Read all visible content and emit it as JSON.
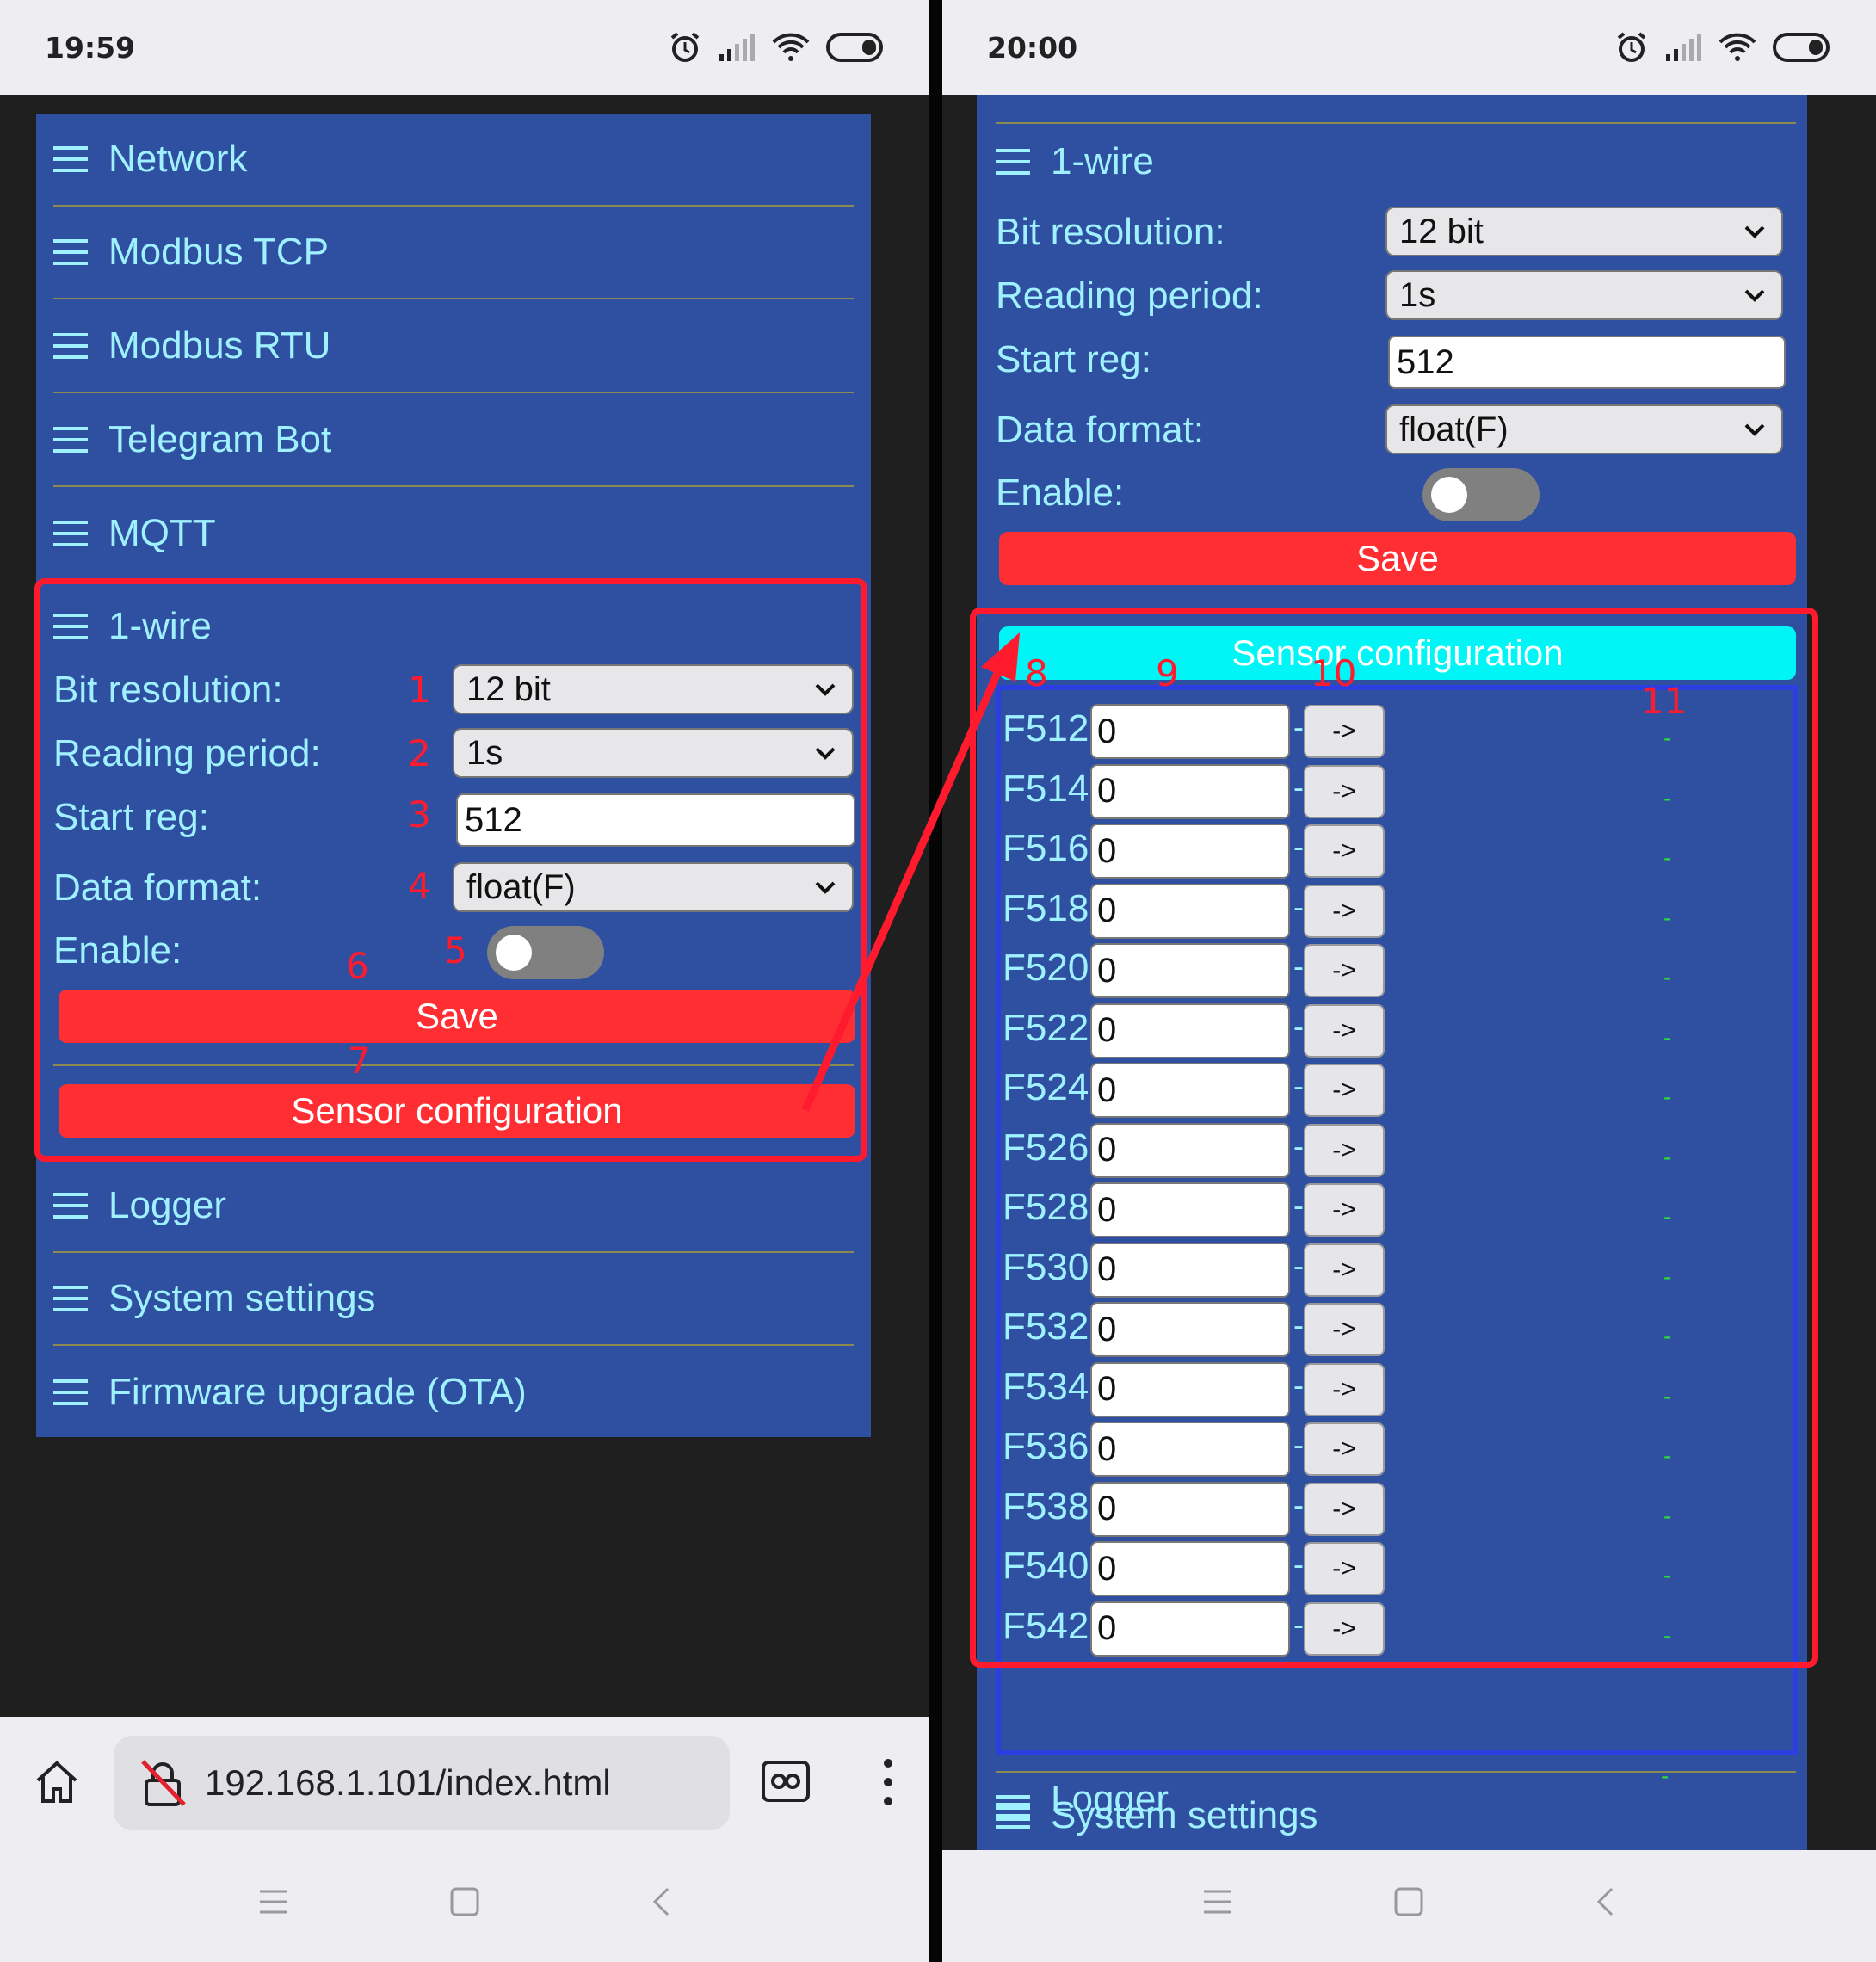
{
  "left": {
    "status_time": "19:59",
    "menu": [
      "Network",
      "Modbus TCP",
      "Modbus RTU",
      "Telegram Bot",
      "MQTT"
    ],
    "onewire": {
      "title": "1-wire",
      "bit_resolution_label": "Bit resolution:",
      "bit_resolution_value": "12 bit",
      "reading_period_label": "Reading period:",
      "reading_period_value": "1s",
      "start_reg_label": "Start reg:",
      "start_reg_value": "512",
      "data_format_label": "Data format:",
      "data_format_value": "float(F)",
      "enable_label": "Enable:",
      "save_label": "Save",
      "sensor_config_label": "Sensor configuration"
    },
    "menu_after": [
      "Logger",
      "System settings",
      "Firmware upgrade (OTA)"
    ],
    "annotations": [
      "1",
      "2",
      "3",
      "4",
      "5",
      "6",
      "7"
    ],
    "url": "192.168.1.101/index.html"
  },
  "right": {
    "status_time": "20:00",
    "onewire": {
      "title": "1-wire",
      "bit_resolution_label": "Bit resolution:",
      "bit_resolution_value": "12 bit",
      "reading_period_label": "Reading period:",
      "reading_period_value": "1s",
      "start_reg_label": "Start reg:",
      "start_reg_value": "512",
      "data_format_label": "Data format:",
      "data_format_value": "float(F)",
      "enable_label": "Enable:",
      "save_label": "Save",
      "sensor_config_label": "Sensor configuration"
    },
    "annotations": [
      "8",
      "9",
      "10",
      "11"
    ],
    "sensors": [
      {
        "reg": "F512",
        "value": "0"
      },
      {
        "reg": "F514",
        "value": "0"
      },
      {
        "reg": "F516",
        "value": "0"
      },
      {
        "reg": "F518",
        "value": "0"
      },
      {
        "reg": "F520",
        "value": "0"
      },
      {
        "reg": "F522",
        "value": "0"
      },
      {
        "reg": "F524",
        "value": "0"
      },
      {
        "reg": "F526",
        "value": "0"
      },
      {
        "reg": "F528",
        "value": "0"
      },
      {
        "reg": "F530",
        "value": "0"
      },
      {
        "reg": "F532",
        "value": "0"
      },
      {
        "reg": "F534",
        "value": "0"
      },
      {
        "reg": "F536",
        "value": "0"
      },
      {
        "reg": "F538",
        "value": "0"
      },
      {
        "reg": "F540",
        "value": "0"
      },
      {
        "reg": "F542",
        "value": "0"
      }
    ],
    "sensor_sep": "-",
    "sensor_button_label": "->",
    "sensor_status": "-",
    "menu_after": [
      "Logger",
      "System settings"
    ]
  },
  "colors": {
    "card": "#2f50a0",
    "text": "#9ff1ff",
    "red_button": "#ff2e33",
    "cyan_button": "#00f6f6",
    "annotation": "#ff1a2e"
  }
}
